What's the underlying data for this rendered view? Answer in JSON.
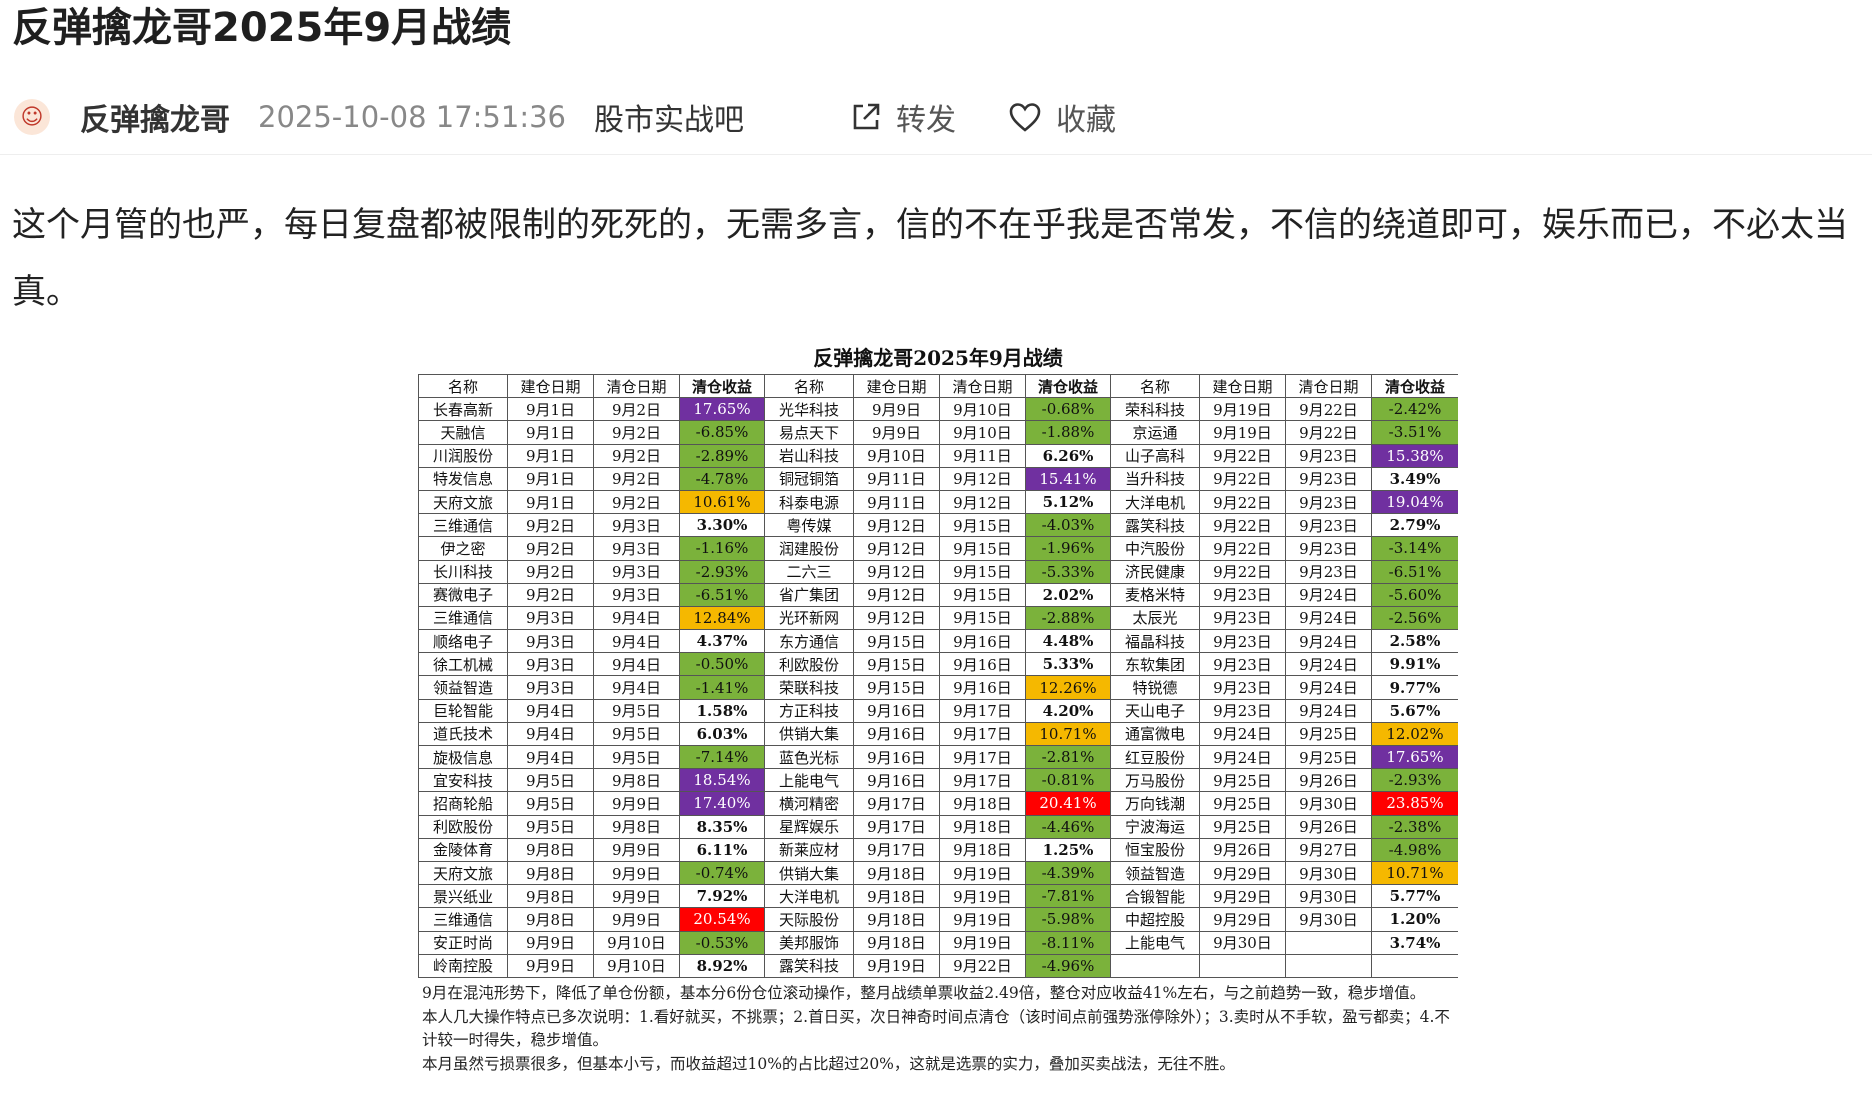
{
  "post": {
    "title": "反弹擒龙哥2025年9月战绩",
    "author": "反弹擒龙哥",
    "time": "2025-10-08 17:51:36",
    "forum": "股市实战吧",
    "forward_label": "转发",
    "collect_label": "收藏",
    "body": "这个月管的也严，每日复盘都被限制的死死的，无需多言，信的不在乎我是否常发，不信的绕道即可，娱乐而已，不必太当真。"
  },
  "figure": {
    "title": "反弹擒龙哥2025年9月战绩",
    "headers": [
      "名称",
      "建仓日期",
      "清仓日期",
      "清仓收益"
    ],
    "rows": [
      [
        [
          "长春高新",
          "9月1日",
          "9月2日",
          "17.65%",
          "hi"
        ],
        [
          "光华科技",
          "9月9日",
          "9月10日",
          "-0.68%",
          "neg"
        ],
        [
          "荣科科技",
          "9月19日",
          "9月22日",
          "-2.42%",
          "neg"
        ]
      ],
      [
        [
          "天融信",
          "9月1日",
          "9月2日",
          "-6.85%",
          "neg"
        ],
        [
          "易点天下",
          "9月9日",
          "9月10日",
          "-1.88%",
          "neg"
        ],
        [
          "京运通",
          "9月19日",
          "9月22日",
          "-3.51%",
          "neg"
        ]
      ],
      [
        [
          "川润股份",
          "9月1日",
          "9月2日",
          "-2.89%",
          "neg"
        ],
        [
          "岩山科技",
          "9月10日",
          "9月11日",
          "6.26%",
          "pos"
        ],
        [
          "山子高科",
          "9月22日",
          "9月23日",
          "15.38%",
          "hi"
        ]
      ],
      [
        [
          "特发信息",
          "9月1日",
          "9月2日",
          "-4.78%",
          "neg"
        ],
        [
          "铜冠铜箔",
          "9月11日",
          "9月12日",
          "15.41%",
          "hi"
        ],
        [
          "当升科技",
          "9月22日",
          "9月23日",
          "3.49%",
          "pos"
        ]
      ],
      [
        [
          "天府文旅",
          "9月1日",
          "9月2日",
          "10.61%",
          "mid"
        ],
        [
          "科泰电源",
          "9月11日",
          "9月12日",
          "5.12%",
          "pos"
        ],
        [
          "大洋电机",
          "9月22日",
          "9月23日",
          "19.04%",
          "hi"
        ]
      ],
      [
        [
          "三维通信",
          "9月2日",
          "9月3日",
          "3.30%",
          "pos"
        ],
        [
          "粤传媒",
          "9月12日",
          "9月15日",
          "-4.03%",
          "neg"
        ],
        [
          "露笑科技",
          "9月22日",
          "9月23日",
          "2.79%",
          "pos"
        ]
      ],
      [
        [
          "伊之密",
          "9月2日",
          "9月3日",
          "-1.16%",
          "neg"
        ],
        [
          "润建股份",
          "9月12日",
          "9月15日",
          "-1.96%",
          "neg"
        ],
        [
          "中汽股份",
          "9月22日",
          "9月23日",
          "-3.14%",
          "neg"
        ]
      ],
      [
        [
          "长川科技",
          "9月2日",
          "9月3日",
          "-2.93%",
          "neg"
        ],
        [
          "二六三",
          "9月12日",
          "9月15日",
          "-5.33%",
          "neg"
        ],
        [
          "济民健康",
          "9月22日",
          "9月23日",
          "-6.51%",
          "neg"
        ]
      ],
      [
        [
          "赛微电子",
          "9月2日",
          "9月3日",
          "-6.51%",
          "neg"
        ],
        [
          "省广集团",
          "9月12日",
          "9月15日",
          "2.02%",
          "pos"
        ],
        [
          "麦格米特",
          "9月23日",
          "9月24日",
          "-5.60%",
          "neg"
        ]
      ],
      [
        [
          "三维通信",
          "9月3日",
          "9月4日",
          "12.84%",
          "mid"
        ],
        [
          "光环新网",
          "9月12日",
          "9月15日",
          "-2.88%",
          "neg"
        ],
        [
          "太辰光",
          "9月23日",
          "9月24日",
          "-2.56%",
          "neg"
        ]
      ],
      [
        [
          "顺络电子",
          "9月3日",
          "9月4日",
          "4.37%",
          "pos"
        ],
        [
          "东方通信",
          "9月15日",
          "9月16日",
          "4.48%",
          "pos"
        ],
        [
          "福晶科技",
          "9月23日",
          "9月24日",
          "2.58%",
          "pos"
        ]
      ],
      [
        [
          "徐工机械",
          "9月3日",
          "9月4日",
          "-0.50%",
          "neg"
        ],
        [
          "利欧股份",
          "9月15日",
          "9月16日",
          "5.33%",
          "pos"
        ],
        [
          "东软集团",
          "9月23日",
          "9月24日",
          "9.91%",
          "pos"
        ]
      ],
      [
        [
          "领益智造",
          "9月3日",
          "9月4日",
          "-1.41%",
          "neg"
        ],
        [
          "荣联科技",
          "9月15日",
          "9月16日",
          "12.26%",
          "mid"
        ],
        [
          "特锐德",
          "9月23日",
          "9月24日",
          "9.77%",
          "pos"
        ]
      ],
      [
        [
          "巨轮智能",
          "9月4日",
          "9月5日",
          "1.58%",
          "pos"
        ],
        [
          "方正科技",
          "9月16日",
          "9月17日",
          "4.20%",
          "pos"
        ],
        [
          "天山电子",
          "9月23日",
          "9月24日",
          "5.67%",
          "pos"
        ]
      ],
      [
        [
          "道氏技术",
          "9月4日",
          "9月5日",
          "6.03%",
          "pos"
        ],
        [
          "供销大集",
          "9月16日",
          "9月17日",
          "10.71%",
          "mid"
        ],
        [
          "通富微电",
          "9月24日",
          "9月25日",
          "12.02%",
          "mid"
        ]
      ],
      [
        [
          "旋极信息",
          "9月4日",
          "9月5日",
          "-7.14%",
          "neg"
        ],
        [
          "蓝色光标",
          "9月16日",
          "9月17日",
          "-2.81%",
          "neg"
        ],
        [
          "红豆股份",
          "9月24日",
          "9月25日",
          "17.65%",
          "hi"
        ]
      ],
      [
        [
          "宜安科技",
          "9月5日",
          "9月8日",
          "18.54%",
          "hi"
        ],
        [
          "上能电气",
          "9月16日",
          "9月17日",
          "-0.81%",
          "neg"
        ],
        [
          "万马股份",
          "9月25日",
          "9月26日",
          "-2.93%",
          "neg"
        ]
      ],
      [
        [
          "招商轮船",
          "9月5日",
          "9月9日",
          "17.40%",
          "hi"
        ],
        [
          "横河精密",
          "9月17日",
          "9月18日",
          "20.41%",
          "top"
        ],
        [
          "万向钱潮",
          "9月25日",
          "9月30日",
          "23.85%",
          "top"
        ]
      ],
      [
        [
          "利欧股份",
          "9月5日",
          "9月8日",
          "8.35%",
          "pos"
        ],
        [
          "星辉娱乐",
          "9月17日",
          "9月18日",
          "-4.46%",
          "neg"
        ],
        [
          "宁波海运",
          "9月25日",
          "9月26日",
          "-2.38%",
          "neg"
        ]
      ],
      [
        [
          "金陵体育",
          "9月8日",
          "9月9日",
          "6.11%",
          "pos"
        ],
        [
          "新莱应材",
          "9月17日",
          "9月18日",
          "1.25%",
          "pos"
        ],
        [
          "恒宝股份",
          "9月26日",
          "9月27日",
          "-4.98%",
          "neg"
        ]
      ],
      [
        [
          "天府文旅",
          "9月8日",
          "9月9日",
          "-0.74%",
          "neg"
        ],
        [
          "供销大集",
          "9月18日",
          "9月19日",
          "-4.39%",
          "neg"
        ],
        [
          "领益智造",
          "9月29日",
          "9月30日",
          "10.71%",
          "mid"
        ]
      ],
      [
        [
          "景兴纸业",
          "9月8日",
          "9月9日",
          "7.92%",
          "pos"
        ],
        [
          "大洋电机",
          "9月18日",
          "9月19日",
          "-7.81%",
          "neg"
        ],
        [
          "合锻智能",
          "9月29日",
          "9月30日",
          "5.77%",
          "pos"
        ]
      ],
      [
        [
          "三维通信",
          "9月8日",
          "9月9日",
          "20.54%",
          "top"
        ],
        [
          "天际股份",
          "9月18日",
          "9月19日",
          "-5.98%",
          "neg"
        ],
        [
          "中超控股",
          "9月29日",
          "9月30日",
          "1.20%",
          "pos"
        ]
      ],
      [
        [
          "安正时尚",
          "9月9日",
          "9月10日",
          "-0.53%",
          "neg"
        ],
        [
          "美邦服饰",
          "9月18日",
          "9月19日",
          "-8.11%",
          "neg"
        ],
        [
          "上能电气",
          "9月30日",
          "",
          "3.74%",
          "pos"
        ]
      ],
      [
        [
          "岭南控股",
          "9月9日",
          "9月10日",
          "8.92%",
          "pos"
        ],
        [
          "露笑科技",
          "9月19日",
          "9月22日",
          "-4.96%",
          "neg"
        ],
        [
          "",
          "",
          "",
          "",
          ""
        ]
      ]
    ],
    "notes": [
      "9月在混沌形势下，降低了单仓份额，基本分6份仓位滚动操作，整月战绩单票收益2.49倍，整仓对应收益41%左右，与之前趋势一致，稳步增值。",
      "本人几大操作特点已多次说明：1.看好就买，不挑票；2.首日买，次日神奇时间点清仓（该时间点前强势涨停除外）；3.卖时从不手软，盈亏都卖；4.不计较一时得失，稳步增值。",
      "本月虽然亏损票很多，但基本小亏，而收益超过10%的占比超过20%，这就是选票的实力，叠加买卖战法，无往不胜。"
    ]
  },
  "colors": {
    "negative": "#7bb23b",
    "mid": "#f5b800",
    "high": "#7030a0",
    "top": "#ff0000"
  },
  "icons": {
    "avatar": "avatar-icon",
    "forward": "share-icon",
    "collect": "heart-icon"
  }
}
